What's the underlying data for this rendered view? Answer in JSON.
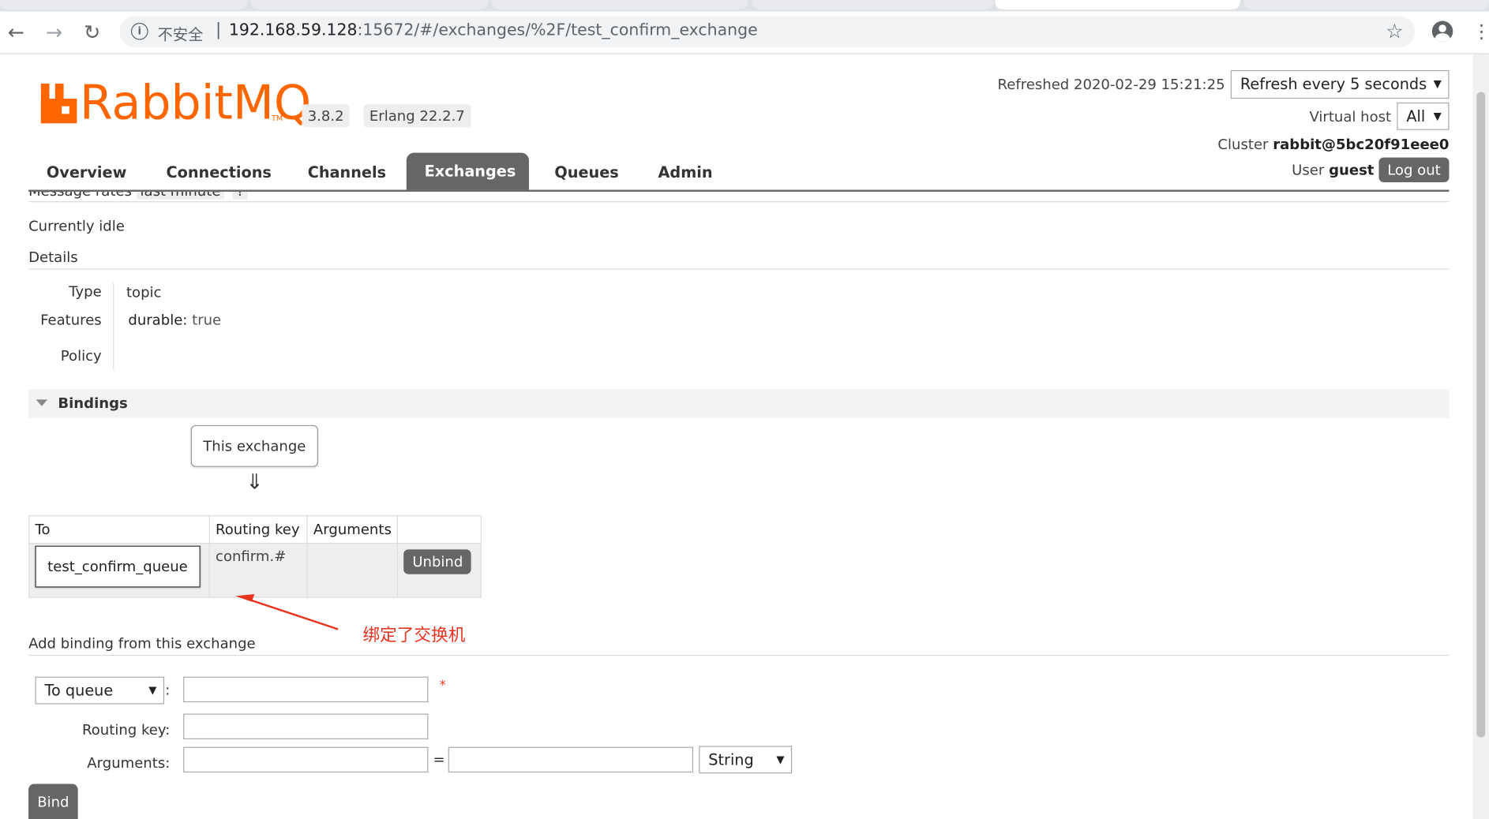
{
  "browser": {
    "insecure_label": "不安全",
    "separator": "|",
    "url_host": "192.168.59.128",
    "url_rest": ":15672/#/exchanges/%2F/test_confirm_exchange"
  },
  "header": {
    "logo_text": "RabbitMQ",
    "logo_tm": "TM",
    "version": "3.8.2",
    "erlang": "Erlang 22.2.7",
    "refreshed": "Refreshed 2020-02-29 15:21:25",
    "refresh_select": "Refresh every 5 seconds",
    "vhost_label": "Virtual host",
    "vhost_value": "All",
    "cluster_label": "Cluster",
    "cluster_value": "rabbit@5bc20f91eee0",
    "user_label": "User",
    "user_value": "guest",
    "logout": "Log out",
    "brand_color": "#ff6600"
  },
  "tabs": [
    {
      "label": "Overview"
    },
    {
      "label": "Connections"
    },
    {
      "label": "Channels"
    },
    {
      "label": "Exchanges",
      "active": true
    },
    {
      "label": "Queues"
    },
    {
      "label": "Admin"
    }
  ],
  "message_rates": {
    "label": "Message rates",
    "period": "last minute",
    "extra": "?"
  },
  "status": "Currently idle",
  "details": {
    "heading": "Details",
    "type_label": "Type",
    "type_value": "topic",
    "features_label": "Features",
    "durable_key": "durable:",
    "durable_value": "true",
    "policy_label": "Policy"
  },
  "bindings": {
    "heading": "Bindings",
    "this_exchange": "This exchange",
    "arrow": "⇓",
    "columns": [
      "To",
      "Routing key",
      "Arguments",
      ""
    ],
    "rows": [
      {
        "to": "test_confirm_queue",
        "routing_key": "confirm.#",
        "arguments": "",
        "action": "Unbind"
      }
    ]
  },
  "annotation": "绑定了交换机",
  "add_binding": {
    "heading": "Add binding from this exchange",
    "destination_select": "To queue",
    "colon": ":",
    "required_mark": "*",
    "routing_key_label": "Routing key:",
    "arguments_label": "Arguments:",
    "equals": "=",
    "type_select": "String",
    "submit": "Bind"
  }
}
